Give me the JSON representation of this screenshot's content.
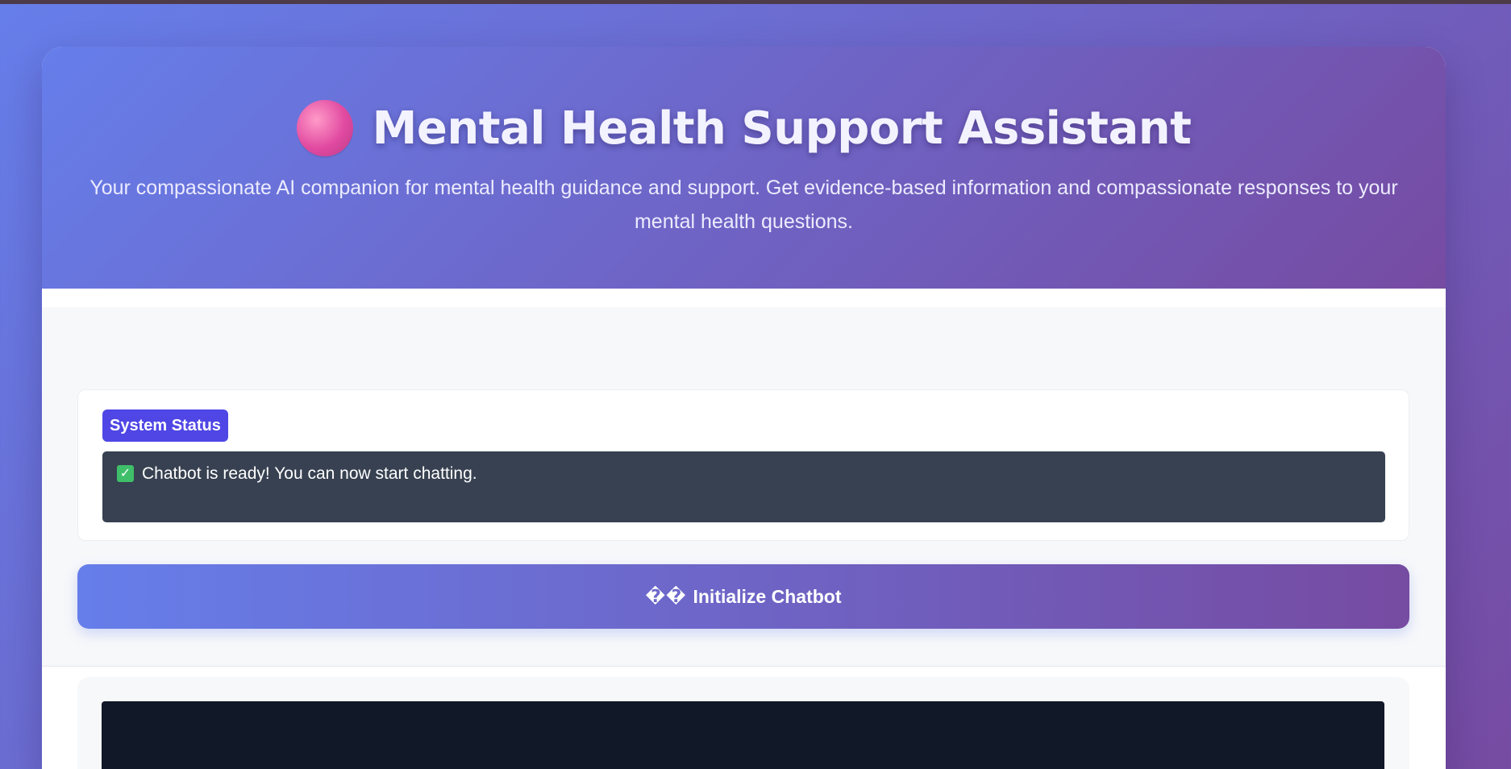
{
  "header": {
    "icon": "brain-icon",
    "title": "Mental Health Support Assistant",
    "subtitle": "Your compassionate AI companion for mental health guidance and support. Get evidence-based information and compassionate responses to your mental health questions."
  },
  "status": {
    "badge_label": "System Status",
    "check_icon": "check-icon",
    "message": "Chatbot is ready! You can now start chatting."
  },
  "actions": {
    "initialize_glyphs": "��",
    "initialize_label": "Initialize Chatbot"
  },
  "theme": {
    "gradient_start": "#667eea",
    "gradient_end": "#764ba2",
    "badge_color": "#4f46e5",
    "status_box_color": "#374151",
    "chat_display_color": "#111827"
  }
}
